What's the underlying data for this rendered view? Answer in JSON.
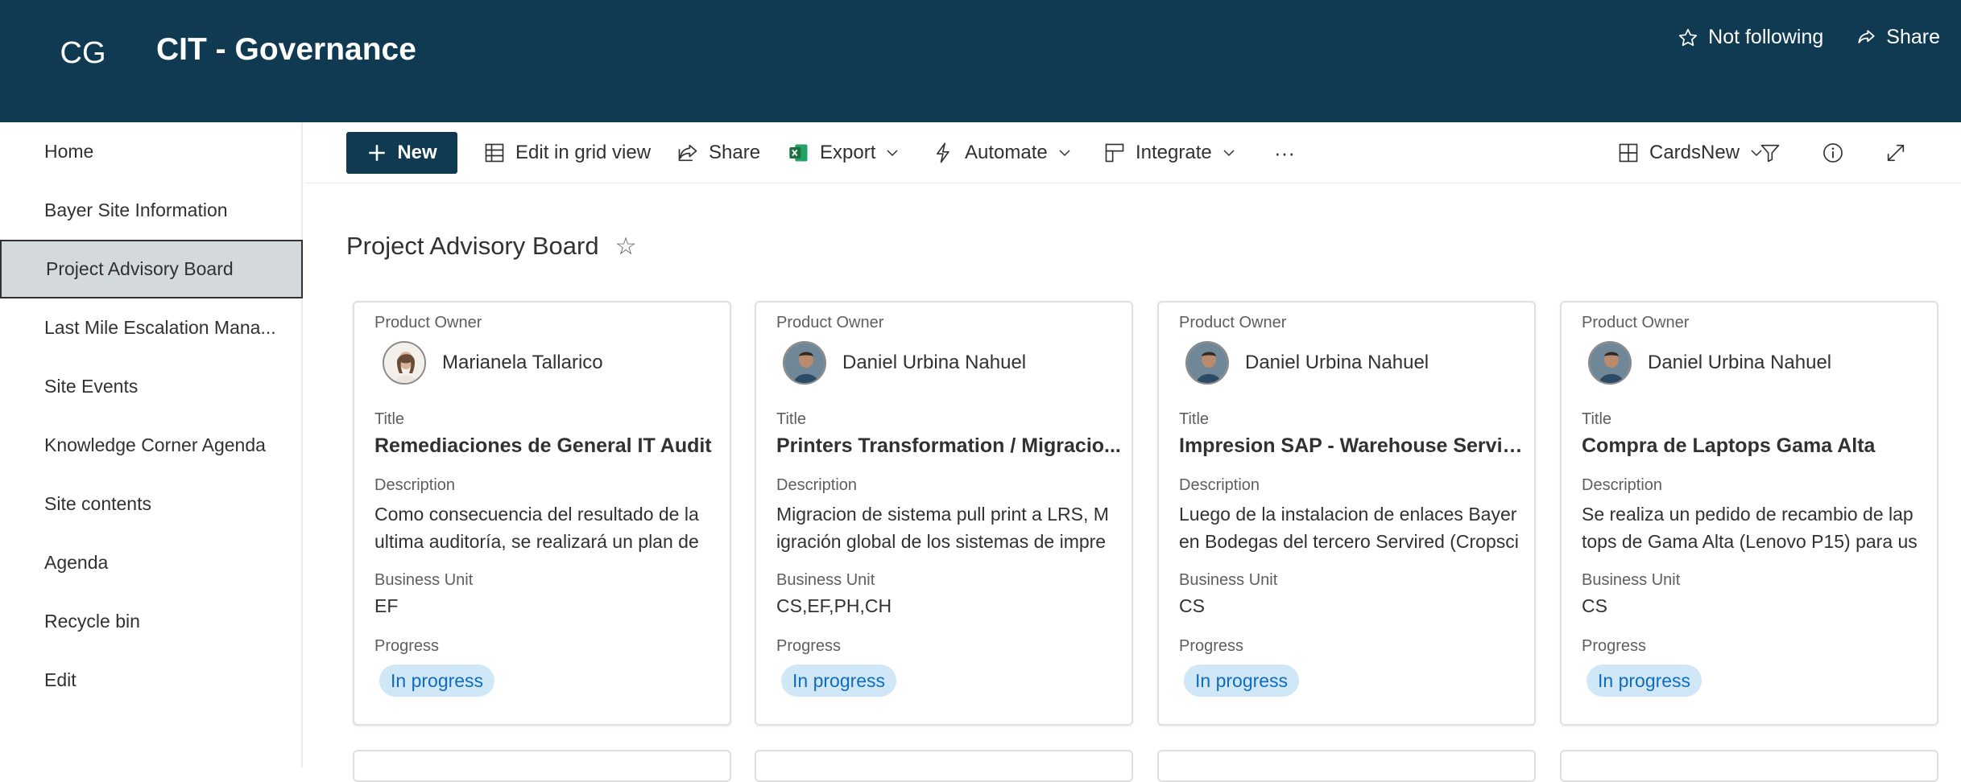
{
  "header": {
    "logo_initials": "CG",
    "site_title": "CIT - Governance",
    "follow_label": "Not following",
    "share_label": "Share"
  },
  "nav": {
    "items": [
      {
        "label": "Home"
      },
      {
        "label": "Bayer Site Information"
      },
      {
        "label": "Project Advisory Board",
        "active": true
      },
      {
        "label": "Last Mile Escalation Mana..."
      },
      {
        "label": "Site Events"
      },
      {
        "label": "Knowledge Corner Agenda"
      },
      {
        "label": "Site contents"
      },
      {
        "label": "Agenda"
      },
      {
        "label": "Recycle bin"
      },
      {
        "label": "Edit"
      }
    ]
  },
  "commandbar": {
    "new_label": "New",
    "edit_grid_label": "Edit in grid view",
    "share_label": "Share",
    "export_label": "Export",
    "automate_label": "Automate",
    "integrate_label": "Integrate",
    "more_label": "···",
    "view_label": "CardsNew"
  },
  "page": {
    "title": "Project Advisory Board"
  },
  "labels": {
    "product_owner": "Product Owner",
    "title": "Title",
    "description": "Description",
    "business_unit": "Business Unit",
    "progress": "Progress"
  },
  "cards": [
    {
      "owner": "Marianela Tallarico",
      "title": "Remediaciones de General IT Audit",
      "description": "Como consecuencia del resultado de la ultima auditoría, se realizará un plan de",
      "business_unit": "EF",
      "progress": "In progress"
    },
    {
      "owner": "Daniel Urbina Nahuel",
      "title": "Printers Transformation / Migracio...",
      "description": "Migracion de sistema pull print a LRS, M igración global de los sistemas de impre",
      "business_unit": "CS,EF,PH,CH",
      "progress": "In progress"
    },
    {
      "owner": "Daniel Urbina Nahuel",
      "title": "Impresion SAP - Warehouse Servired",
      "description": "Luego de la instalacion de enlaces Bayer en Bodegas del tercero Servired (Cropsci",
      "business_unit": "CS",
      "progress": "In progress"
    },
    {
      "owner": "Daniel Urbina Nahuel",
      "title": "Compra de Laptops Gama Alta",
      "description": "Se realiza un pedido de recambio de lap tops de Gama Alta (Lenovo P15) para us",
      "business_unit": "CS",
      "progress": "In progress"
    }
  ],
  "colors": {
    "header_bg": "#0f3a52",
    "pill_bg": "#d0e7f8",
    "pill_text": "#0f6cbd",
    "excel_green": "#1d6f42"
  }
}
